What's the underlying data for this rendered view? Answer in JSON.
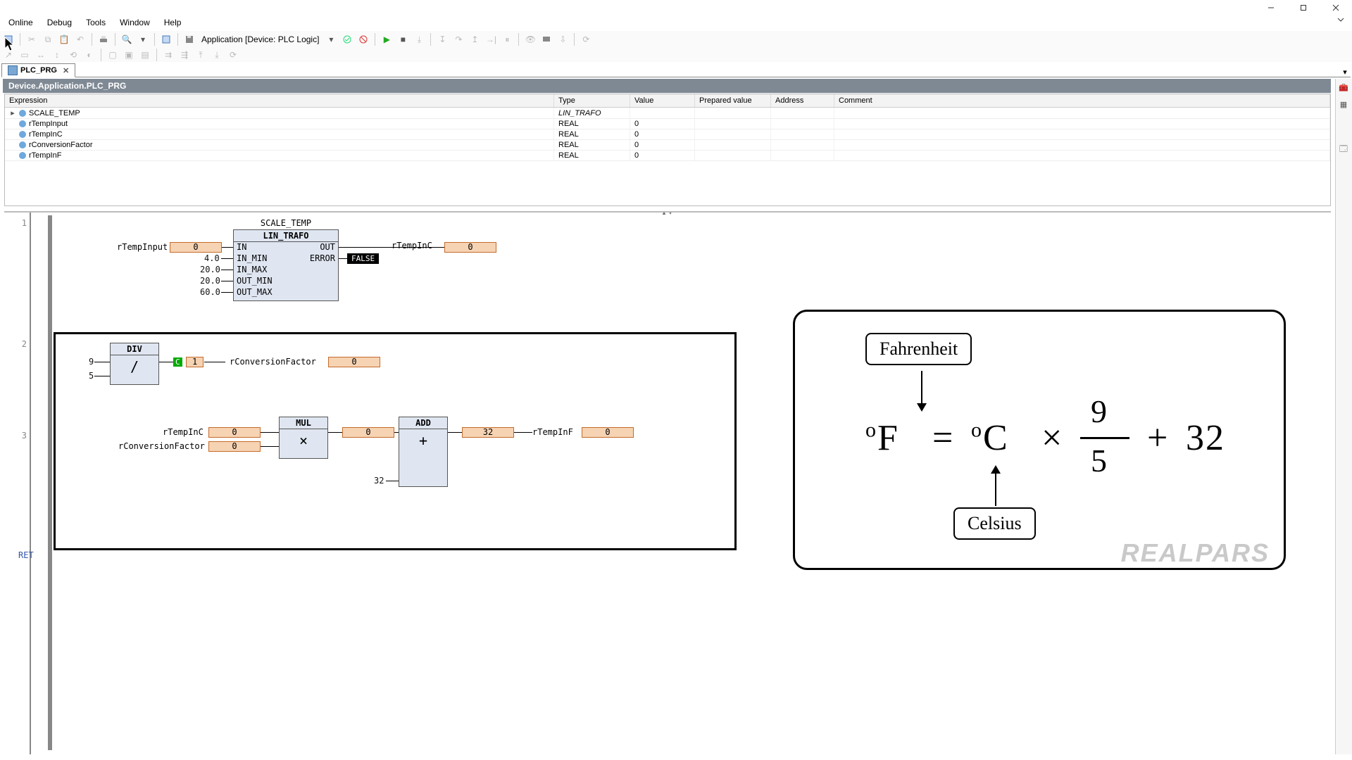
{
  "window": {
    "min": "–",
    "max": "❐",
    "close": "✕"
  },
  "menubar": [
    "Online",
    "Debug",
    "Tools",
    "Window",
    "Help"
  ],
  "toolbar1": {
    "app_label": "Application [Device: PLC Logic]"
  },
  "tabs": [
    {
      "label": "PLC_PRG"
    }
  ],
  "breadcrumb": "Device.Application.PLC_PRG",
  "vars": {
    "cols": [
      "Expression",
      "Type",
      "Value",
      "Prepared value",
      "Address",
      "Comment"
    ],
    "rows": [
      {
        "name": "SCALE_TEMP",
        "type": "LIN_TRAFO",
        "value": "",
        "expandable": true
      },
      {
        "name": "rTempInput",
        "type": "REAL",
        "value": "0"
      },
      {
        "name": "rTempInC",
        "type": "REAL",
        "value": "0"
      },
      {
        "name": "rConversionFactor",
        "type": "REAL",
        "value": "0"
      },
      {
        "name": "rTempInF",
        "type": "REAL",
        "value": "0"
      }
    ]
  },
  "cfc": {
    "gutter": [
      "1",
      "2",
      "3"
    ],
    "block1": {
      "instance": "SCALE_TEMP",
      "fb": "LIN_TRAFO",
      "left_ports": [
        "IN",
        "IN_MIN",
        "IN_MAX",
        "OUT_MIN",
        "OUT_MAX"
      ],
      "right_ports": [
        "OUT",
        "ERROR"
      ],
      "left_vals": {
        "in_var": "rTempInput",
        "in_val": "0",
        "in_min": "4.0",
        "in_max": "20.0",
        "out_min": "20.0",
        "out_max": "60.0"
      },
      "right_vals": {
        "out_var": "rTempInC",
        "out_val": "0",
        "error": "FALSE"
      }
    },
    "block2": {
      "op": "DIV",
      "sym": "/",
      "a": "9",
      "b": "5",
      "c_literal": "1",
      "out_var": "rConversionFactor",
      "out_val": "0"
    },
    "block3": {
      "mul": {
        "op": "MUL",
        "sym": "×",
        "a_var": "rTempInC",
        "a_val": "0",
        "b_var": "rConversionFactor",
        "b_val": "0",
        "out_val": "0"
      },
      "add": {
        "op": "ADD",
        "sym": "+",
        "b_const": "32",
        "a_val": "32",
        "out_var": "rTempInF",
        "out_val": "0"
      }
    },
    "ret": "RET"
  },
  "formula": {
    "fahrenheit": "Fahrenheit",
    "celsius": "Celsius",
    "degF": "°F",
    "eq": "=",
    "degC": "°C",
    "times": "×",
    "num": "9",
    "den": "5",
    "plus": "+",
    "const": "32",
    "brand": "REALPARS"
  }
}
